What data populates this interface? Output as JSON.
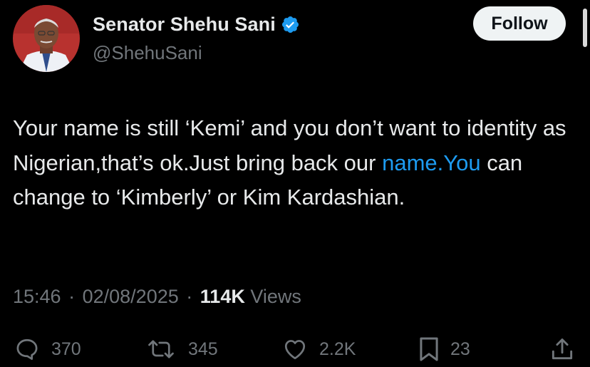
{
  "author": {
    "display_name": "Senator Shehu Sani",
    "handle": "@ShehuSani",
    "verified": true
  },
  "follow_button": {
    "label": "Follow"
  },
  "tweet": {
    "text_part1": "Your name is still ‘Kemi’ and you don’t want to identity as Nigerian,that’s ok.Just bring back our ",
    "link_text": "name.You",
    "text_part2": " can change to ‘Kimberly’ or Kim Kardashian."
  },
  "meta": {
    "time": "15:46",
    "separator": "·",
    "date": "02/08/2025",
    "views_count": "114K",
    "views_label": "Views"
  },
  "actions": {
    "replies": "370",
    "reposts": "345",
    "likes": "2.2K",
    "bookmarks": "23"
  },
  "colors": {
    "background": "#000000",
    "text": "#e7e9ea",
    "secondary": "#71767b",
    "accent": "#1d9bf0"
  },
  "icons": [
    "verified-badge-icon",
    "reply-icon",
    "repost-icon",
    "like-icon",
    "bookmark-icon",
    "share-icon"
  ]
}
